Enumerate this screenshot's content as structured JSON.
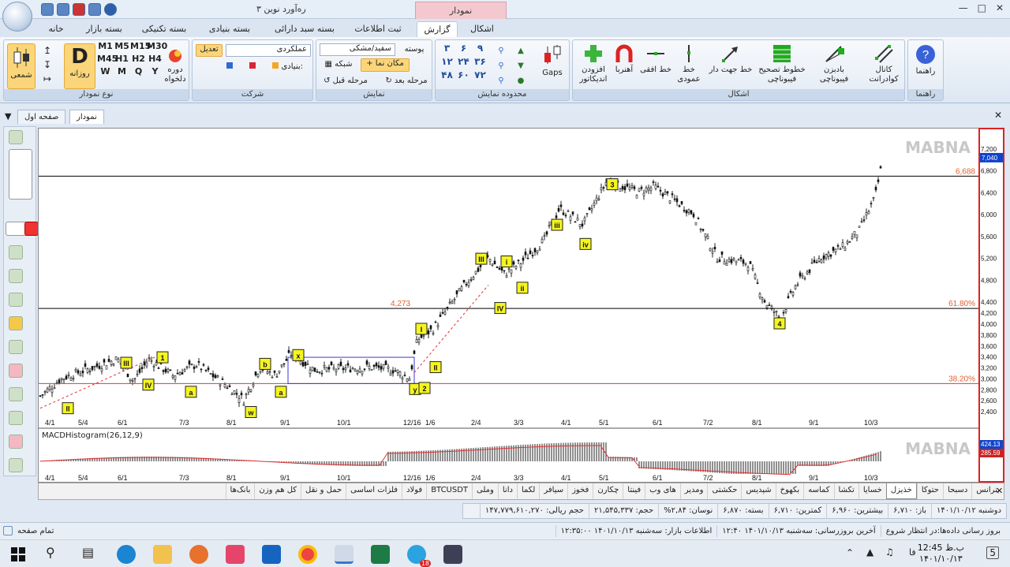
{
  "window": {
    "title": "ره‌آورد نوین ۳",
    "context_tab": "نمودار"
  },
  "ribbon_tabs": [
    "خانه",
    "بسته بازار",
    "بسته تکنیکی",
    "بسته بنیادی",
    "بسته سبد دارائی",
    "ثبت اطلاعات",
    "گزارش",
    "اشکال"
  ],
  "ribbon": {
    "chart_type_group": {
      "label": "نوع نمودار",
      "candle": "شمعی",
      "daily": "روزانه",
      "periodic": "دوره دلخواه",
      "periods": [
        "M1",
        "M5",
        "M15",
        "M30",
        "M45",
        "H1",
        "H2",
        "H4",
        "W",
        "M",
        "Q",
        "Y"
      ],
      "big_letter": "D"
    },
    "company_group": {
      "label": "شرکت",
      "edit": "تعدیل",
      "basis": "عملکردی",
      "fundamental": "بنیادی:"
    },
    "display_group": {
      "label": "نمایش",
      "theme": "سفید/مشکی",
      "theme_label": "پوسته",
      "cursor": "مکان نما",
      "grid": "شبکه",
      "next_step": "مرحله بعد",
      "prev_step": "مرحله قبل"
    },
    "range_group": {
      "label": "محدوده نمایش",
      "digits": [
        "۳",
        "۶",
        "۹",
        "۱۲",
        "۲۴",
        "۳۶",
        "۴۸",
        "۶۰",
        "۷۲"
      ],
      "gaps": "Gaps"
    },
    "shapes_group": {
      "label": "اشکال",
      "items": [
        "کانال کوادرانت",
        "بادبزن فیبوناچی",
        "خطوط تصحیح فیبوناچی",
        "خط جهت دار",
        "خط عمودی",
        "خط افقی",
        "آهنربا",
        "افزودن اندیکاتور"
      ]
    },
    "help_group": {
      "label": "راهنما",
      "item": "راهنما"
    }
  },
  "doc_tabs": {
    "first_page": "صفحه اول",
    "chart": "نمودار"
  },
  "chart": {
    "watermark": "MABNA",
    "macd_label": "MACDHistogram(26,12,9)",
    "levels": [
      {
        "label": "6,688",
        "value": 6688,
        "color": "#000000"
      },
      {
        "label": "61.80%",
        "value": 4273,
        "color": "#000000",
        "left_label": "4,273"
      },
      {
        "label": "38.20%",
        "value": 2900,
        "color": "#d04040"
      }
    ],
    "current_price": "7,040",
    "macd_values": [
      "424.13",
      "285.59"
    ],
    "y_ticks": [
      "7,200",
      "6,800",
      "6,400",
      "6,000",
      "5,600",
      "5,200",
      "4,800",
      "4,400",
      "4,200",
      "4,000",
      "3,800",
      "3,600",
      "3,400",
      "3,200",
      "3,000",
      "2,800",
      "2,600",
      "2,400"
    ],
    "x_ticks": [
      "4/1",
      "5/4",
      "6/1",
      "7/3",
      "8/1",
      "9/1",
      "10/1",
      "12/16",
      "1/6",
      "2/4",
      "3/3",
      "4/1",
      "5/1",
      "6/1",
      "7/2",
      "8/1",
      "9/1",
      "10/3"
    ],
    "wave_labels": [
      "II",
      "III",
      "IV",
      "1",
      "a",
      "b",
      "a",
      "w",
      "x",
      "y",
      "2",
      "II",
      "I",
      "IV",
      "III",
      "i",
      "ii",
      "iii",
      "iv",
      "3",
      "4"
    ]
  },
  "symbol_tabs": [
    "بترانس",
    "دسبحا",
    "حتوکا",
    "خذیزل",
    "خسایا",
    "تکشا",
    "کماسه",
    "بکهوخ",
    "شپدیس",
    "حکشتی",
    "ومدیر",
    "های وب",
    "فینتا",
    "چکارن",
    "فخوز",
    "سیافر",
    "لکما",
    "دانا",
    "وملی",
    "BTCUSDT",
    "فولاد",
    "فلزات اساسی",
    "حمل و نقل",
    "کل هم وزن",
    "بانک‌ها"
  ],
  "active_symbol": "خذیزل",
  "info_bar": [
    "دوشنبه ۱۴۰۱/۱۰/۱۲",
    "باز: ۶,۷۱۰",
    "بیشترین: ۶,۹۶۰",
    "کمترین: ۶,۷۱۰",
    "بسته: ۶,۸۷۰",
    "نوسان: ۲,۸۴%",
    "حجم: ۲۱,۵۴۵,۳۳۷",
    "حجم ریالی: ۱۴۷,۷۷۹,۶۱۰,۲۷۰"
  ],
  "status": {
    "left": "تمام صفحه",
    "update": "بروز رسانی داده‌ها:در انتظار شروع",
    "last_update": "آخرین بروزرسانی: سه‌شنبه ۱۴۰۱/۱۰/۱۳ ۱۲:۴۰",
    "market": "اطلاعات بازار: سه‌شنبه ۱۴۰۱/۱۰/۱۳ ۱۲:۳۵:۰۰"
  },
  "taskbar": {
    "time": "12:45 ب.ظ",
    "date": "۱۴۰۱/۱۰/۱۳",
    "lang": "فا",
    "notifications": "5",
    "telegram_badge": "18"
  }
}
